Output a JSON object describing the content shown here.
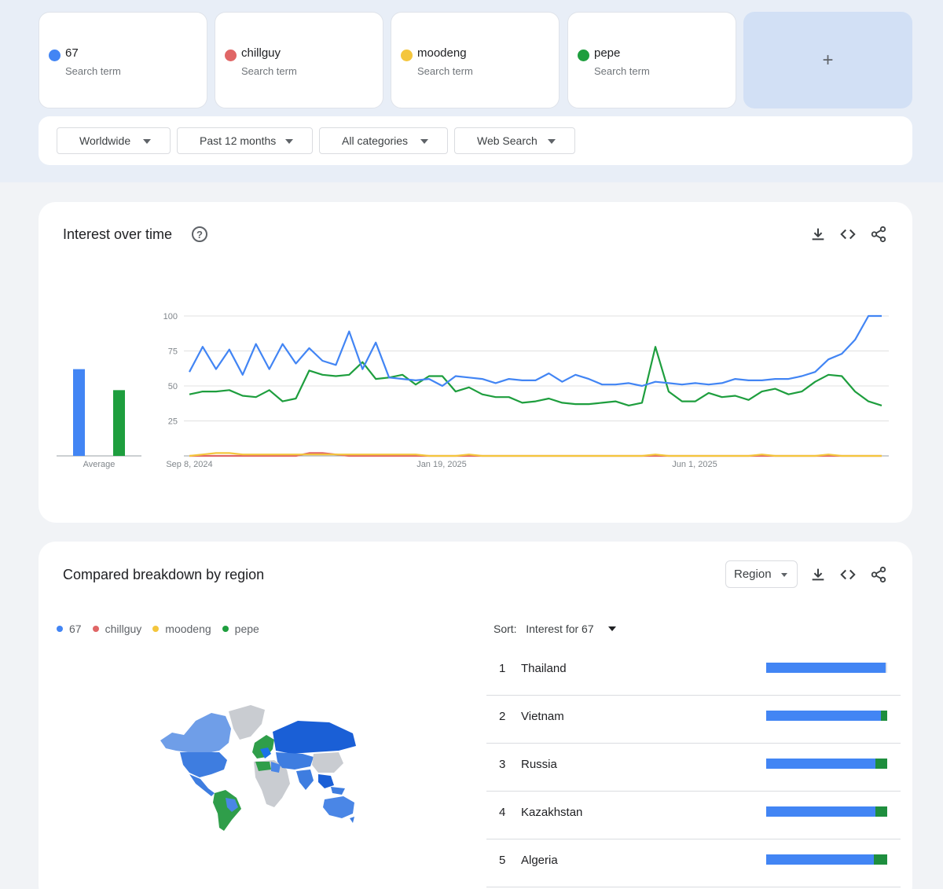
{
  "terms": [
    {
      "name": "67",
      "sub": "Search term",
      "color": "#4285f4"
    },
    {
      "name": "chillguy",
      "sub": "Search term",
      "color": "#e06666"
    },
    {
      "name": "moodeng",
      "sub": "Search term",
      "color": "#f4c63d"
    },
    {
      "name": "pepe",
      "sub": "Search term",
      "color": "#1e9e3e"
    }
  ],
  "add_label": "+",
  "filters": {
    "location": "Worldwide",
    "time": "Past 12 months",
    "category": "All categories",
    "search_type": "Web Search"
  },
  "interest": {
    "title": "Interest over time",
    "help_glyph": "?",
    "icons": [
      "download-icon",
      "embed-code-icon",
      "share-icon"
    ]
  },
  "chart_data": {
    "type": "line",
    "x_tick_labels": [
      "Sep 8, 2024",
      "Jan 19, 2025",
      "Jun 1, 2025"
    ],
    "y_ticks": [
      25,
      50,
      75,
      100
    ],
    "ylim": [
      0,
      100
    ],
    "average_label": "Average",
    "averages": [
      {
        "term": "67",
        "value": 62,
        "color": "#4285f4"
      },
      {
        "term": "chillguy",
        "value": 0,
        "color": "#e06666"
      },
      {
        "term": "moodeng",
        "value": 0,
        "color": "#f4c63d"
      },
      {
        "term": "pepe",
        "value": 47,
        "color": "#1e9e3e"
      }
    ],
    "series": [
      {
        "name": "67",
        "color": "#4285f4",
        "values": [
          60,
          78,
          62,
          76,
          58,
          80,
          62,
          80,
          66,
          77,
          68,
          65,
          89,
          62,
          81,
          56,
          55,
          54,
          55,
          50,
          57,
          56,
          55,
          52,
          55,
          54,
          54,
          59,
          53,
          58,
          55,
          51,
          51,
          52,
          50,
          53,
          52,
          51,
          52,
          51,
          52,
          55,
          54,
          54,
          55,
          55,
          57,
          60,
          69,
          73,
          83,
          100,
          100
        ]
      },
      {
        "name": "chillguy",
        "color": "#e06666",
        "values": [
          0,
          0,
          0,
          0,
          0,
          0,
          0,
          0,
          0,
          2,
          2,
          1,
          0,
          0,
          0,
          0,
          0,
          0,
          0,
          0,
          0,
          0,
          0,
          0,
          0,
          0,
          0,
          0,
          0,
          0,
          0,
          0,
          0,
          0,
          0,
          0,
          0,
          0,
          0,
          0,
          0,
          0,
          0,
          0,
          0,
          0,
          0,
          0,
          0,
          0,
          0,
          0,
          0
        ]
      },
      {
        "name": "moodeng",
        "color": "#f4c63d",
        "values": [
          0,
          1,
          2,
          2,
          1,
          1,
          1,
          1,
          1,
          1,
          1,
          1,
          1,
          1,
          1,
          1,
          1,
          1,
          0,
          0,
          0,
          1,
          0,
          0,
          0,
          0,
          0,
          0,
          0,
          0,
          0,
          0,
          0,
          0,
          0,
          1,
          0,
          0,
          0,
          0,
          0,
          0,
          0,
          1,
          0,
          0,
          0,
          0,
          1,
          0,
          0,
          0,
          0
        ]
      },
      {
        "name": "pepe",
        "color": "#1e9e3e",
        "values": [
          44,
          46,
          46,
          47,
          43,
          42,
          47,
          39,
          41,
          61,
          58,
          57,
          58,
          67,
          55,
          56,
          58,
          51,
          57,
          57,
          46,
          49,
          44,
          42,
          42,
          38,
          39,
          41,
          38,
          37,
          37,
          38,
          39,
          36,
          38,
          78,
          46,
          39,
          39,
          45,
          42,
          43,
          40,
          46,
          48,
          44,
          46,
          53,
          58,
          57,
          46,
          39,
          36
        ]
      }
    ]
  },
  "region": {
    "title": "Compared breakdown by region",
    "button_label": "Region",
    "icons": [
      "download-icon",
      "embed-code-icon",
      "share-icon"
    ],
    "legend": [
      {
        "name": "67",
        "color": "#4285f4"
      },
      {
        "name": "chillguy",
        "color": "#e06666"
      },
      {
        "name": "moodeng",
        "color": "#f4c63d"
      },
      {
        "name": "pepe",
        "color": "#1e9e3e"
      }
    ],
    "sort_label": "Sort:",
    "sort_value": "Interest for 67",
    "rows": [
      {
        "rank": "1",
        "name": "Thailand",
        "share_67": 0.99,
        "share_pepe": 0.0
      },
      {
        "rank": "2",
        "name": "Vietnam",
        "share_67": 0.95,
        "share_pepe": 0.05
      },
      {
        "rank": "3",
        "name": "Russia",
        "share_67": 0.9,
        "share_pepe": 0.1
      },
      {
        "rank": "4",
        "name": "Kazakhstan",
        "share_67": 0.9,
        "share_pepe": 0.1
      },
      {
        "rank": "5",
        "name": "Algeria",
        "share_67": 0.89,
        "share_pepe": 0.11
      }
    ]
  }
}
